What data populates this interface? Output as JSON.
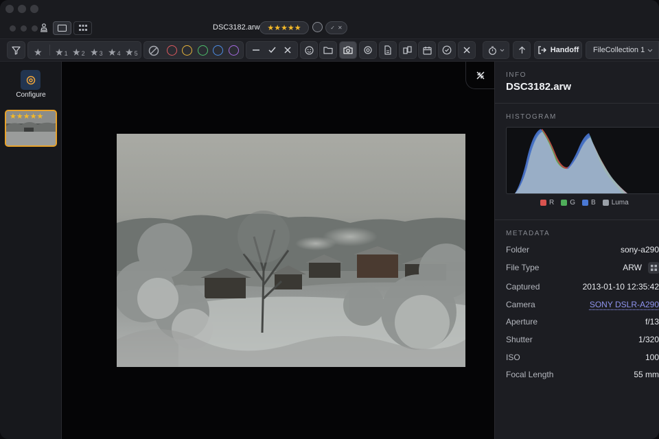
{
  "window": {
    "filename": "DSC3182.arw",
    "rating_stars": "★★★★★",
    "flag_check": "✓",
    "flag_x": "✕"
  },
  "toolbar": {
    "stars": [
      {
        "glyph": "★",
        "num": ""
      },
      {
        "glyph": "★",
        "num": "1"
      },
      {
        "glyph": "★",
        "num": "2"
      },
      {
        "glyph": "★",
        "num": "3"
      },
      {
        "glyph": "★",
        "num": "4"
      },
      {
        "glyph": "★",
        "num": "5"
      }
    ],
    "color_labels": [
      "#e05a5f",
      "#e8b53a",
      "#4cbf6b",
      "#4d8ee8",
      "#a569e0"
    ],
    "handoff_label": "Handoff",
    "collection_label": "FileCollection 1",
    "active_tool": "camera-icon"
  },
  "sidebar": {
    "configure_label": "Configure",
    "thumb_stars": "★★★★★"
  },
  "info": {
    "section_label": "INFO",
    "title": "DSC3182.arw"
  },
  "histogram": {
    "section_label": "HISTOGRAM",
    "legend": [
      {
        "label": "R",
        "color": "#d9534f"
      },
      {
        "label": "G",
        "color": "#4fae5a"
      },
      {
        "label": "B",
        "color": "#4a78d4"
      },
      {
        "label": "Luma",
        "color": "#9aa0a8"
      }
    ]
  },
  "metadata": {
    "section_label": "METADATA",
    "rows": [
      {
        "key": "Folder",
        "value": "sony-a290"
      },
      {
        "key": "File Type",
        "value": "ARW"
      },
      {
        "key": "Captured",
        "value": "2013-01-10 12:35:42"
      },
      {
        "key": "Camera",
        "value": "SONY DSLR-A290"
      },
      {
        "key": "Aperture",
        "value": "f/13"
      },
      {
        "key": "Shutter",
        "value": "1/320"
      },
      {
        "key": "ISO",
        "value": "100"
      },
      {
        "key": "Focal Length",
        "value": "55 mm"
      }
    ]
  },
  "colors": {
    "accent_orange": "#e8a22a",
    "star_gold": "#f4b928",
    "link": "#8f94f0"
  }
}
